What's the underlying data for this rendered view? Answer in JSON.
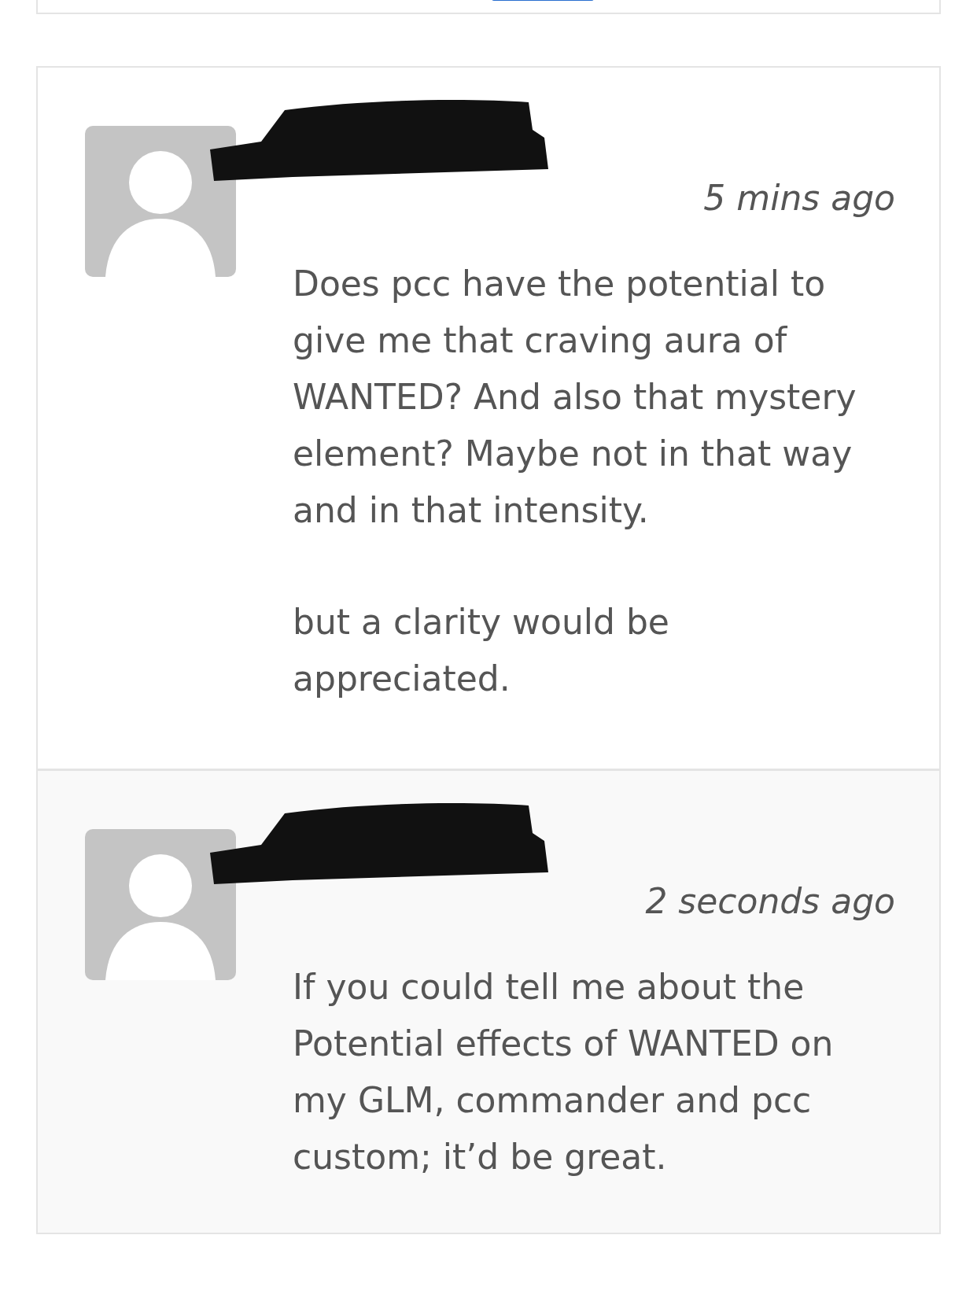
{
  "comments": [
    {
      "time": "5 mins ago",
      "highlighted": false,
      "paragraphs": [
        "Does pcc have the potential to give me that craving aura of WANTED? And also that mystery element? Maybe not in that way and in that intensity.",
        "but a clarity would be appreciated."
      ]
    },
    {
      "time": "2 seconds ago",
      "highlighted": true,
      "paragraphs": [
        "If you could tell me about the Potential effects of WANTED on my GLM, commander and pcc custom; it’d be great."
      ]
    }
  ]
}
